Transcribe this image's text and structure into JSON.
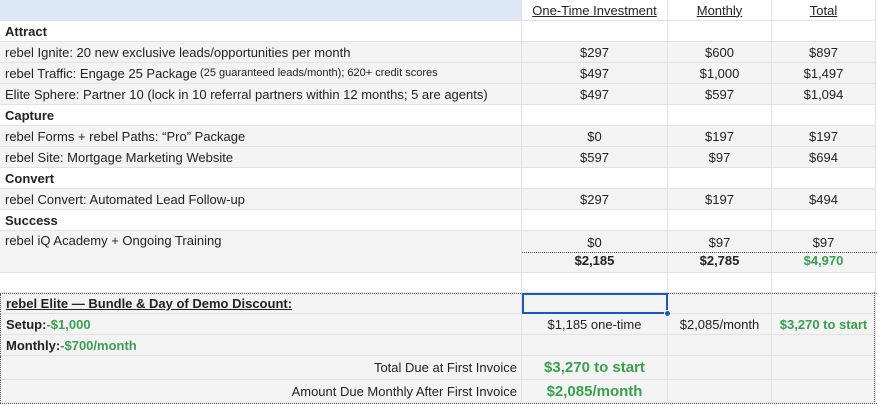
{
  "header": {
    "col1": "One-Time Investment",
    "col2": "Monthly",
    "col3": "Total"
  },
  "sections": {
    "attract": "Attract",
    "capture": "Capture",
    "convert": "Convert",
    "success": "Success"
  },
  "rows": [
    {
      "label": "rebel Ignite: 20 new exclusive leads/opportunities per month",
      "note": "",
      "one_time": "$297",
      "monthly": "$600",
      "total": "$897"
    },
    {
      "label": "rebel Traffic: Engage 25 Package",
      "note": " (25 guaranteed leads/month); 620+ credit scores",
      "one_time": "$497",
      "monthly": "$1,000",
      "total": "$1,497"
    },
    {
      "label": "Elite Sphere: Partner 10 (lock in 10 referral partners within 12 months; 5 are agents)",
      "note": "",
      "one_time": "$497",
      "monthly": "$597",
      "total": "$1,094"
    },
    {
      "label": "rebel Forms + rebel Paths: “Pro” Package",
      "note": "",
      "one_time": "$0",
      "monthly": "$197",
      "total": "$197"
    },
    {
      "label": "rebel Site: Mortgage Marketing Website",
      "note": "",
      "one_time": "$597",
      "monthly": "$97",
      "total": "$694"
    },
    {
      "label": "rebel Convert: Automated Lead Follow-up",
      "note": "",
      "one_time": "$297",
      "monthly": "$197",
      "total": "$494"
    },
    {
      "label": "rebel iQ Academy + Ongoing Training",
      "note": "",
      "one_time": "$0",
      "monthly": "$97",
      "total": "$97"
    }
  ],
  "totals": {
    "one_time": "$2,185",
    "monthly": "$2,785",
    "total": "$4,970"
  },
  "bundle": {
    "title": "rebel Elite — Bundle & Day of Demo Discount:",
    "setup_label": "Setup: -$1,000",
    "monthly_label": "Monthly: -$700/month",
    "one_time": "$1,185 one-time",
    "monthly": "$2,085/month",
    "total": "$3,270 to start"
  },
  "due": {
    "first_label": "Total Due at First Invoice",
    "first_value": "$3,270 to start",
    "monthly_label": "Amount Due Monthly After First Invoice",
    "monthly_value": "$2,085/month"
  },
  "colors": {
    "header_bg": "#dbe7f6",
    "row_grey": "#f3f3f3",
    "accent_green": "#38a04f",
    "selection_blue": "#1a57c2"
  }
}
